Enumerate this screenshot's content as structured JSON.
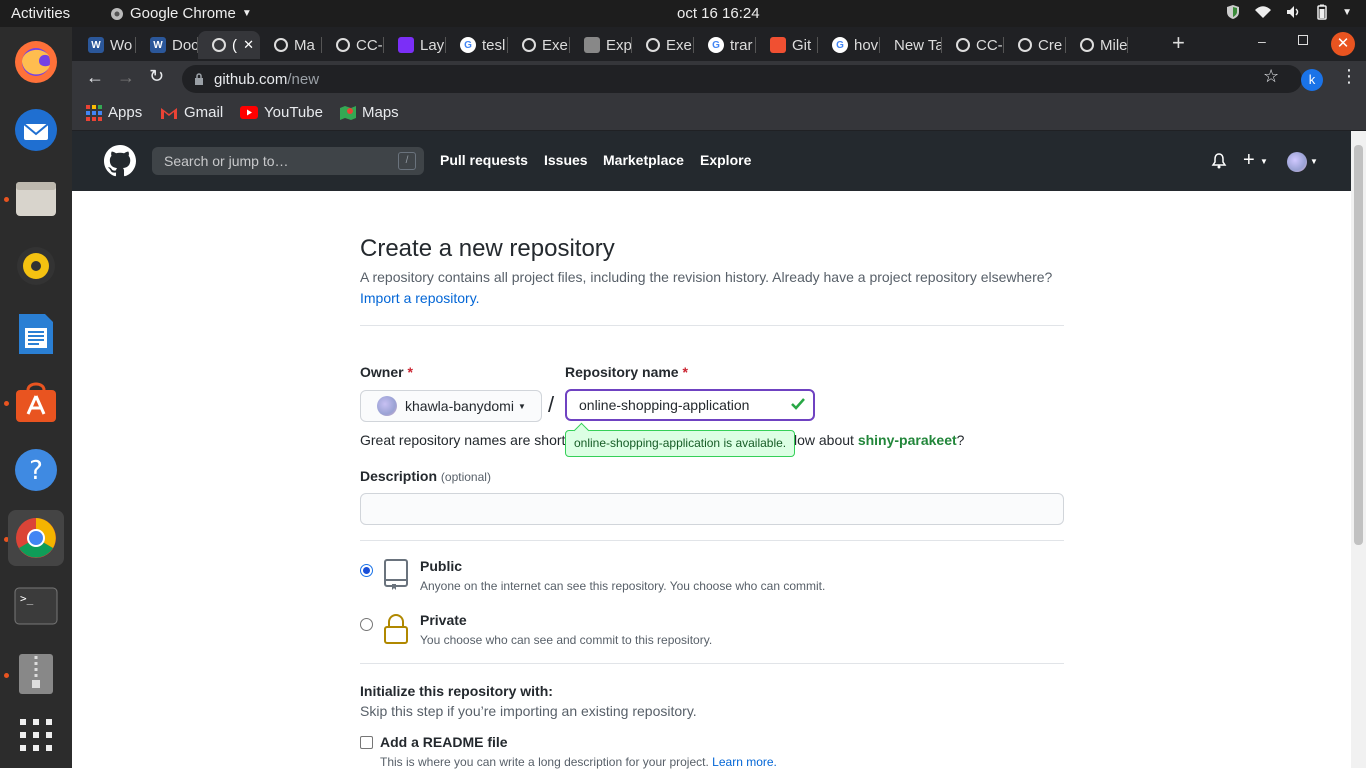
{
  "os": {
    "activities": "Activities",
    "app_name": "Google Chrome",
    "clock": "oct 16  16:24"
  },
  "dock": {
    "items": [
      "firefox",
      "thunderbird",
      "files",
      "rhythmbox",
      "libreoffice-writer",
      "ubuntu-software",
      "help",
      "chrome",
      "terminal",
      "archive-manager",
      "show-applications"
    ]
  },
  "tabs": [
    {
      "label": "Wo",
      "icon": "word-icon",
      "color": "#2b579a"
    },
    {
      "label": "Doc",
      "icon": "word-icon",
      "color": "#2b579a"
    },
    {
      "label": "(",
      "icon": "github-icon",
      "color": "#000000",
      "active": true
    },
    {
      "label": "Ma",
      "icon": "github-icon",
      "color": "#000000"
    },
    {
      "label": "CC-",
      "icon": "github-icon",
      "color": "#000000"
    },
    {
      "label": "Lay",
      "icon": "layout-icon",
      "color": "#7b2ff7"
    },
    {
      "label": "tesl",
      "icon": "google-icon",
      "color": "#4285f4"
    },
    {
      "label": "Exe",
      "icon": "github-icon",
      "color": "#000000"
    },
    {
      "label": "Exp",
      "icon": "gear-icon",
      "color": "#888888"
    },
    {
      "label": "Exe",
      "icon": "github-icon",
      "color": "#000000"
    },
    {
      "label": "trar",
      "icon": "google-icon",
      "color": "#4285f4"
    },
    {
      "label": "Git",
      "icon": "git-icon",
      "color": "#f05032"
    },
    {
      "label": "hov",
      "icon": "google-icon",
      "color": "#4285f4"
    },
    {
      "label": "New Ta",
      "icon": "",
      "color": ""
    },
    {
      "label": "CC-",
      "icon": "github-icon",
      "color": "#000000"
    },
    {
      "label": "Cre",
      "icon": "github-icon",
      "color": "#000000"
    },
    {
      "label": "Mile",
      "icon": "github-icon",
      "color": "#000000"
    }
  ],
  "omnibox": {
    "host": "github.com",
    "path": "/new"
  },
  "profile_initial": "k",
  "bookmarks": [
    {
      "label": "Apps",
      "icon": "apps-icon"
    },
    {
      "label": "Gmail",
      "icon": "gmail-icon"
    },
    {
      "label": "YouTube",
      "icon": "youtube-icon"
    },
    {
      "label": "Maps",
      "icon": "maps-icon"
    }
  ],
  "github": {
    "search_placeholder": "Search or jump to…",
    "search_key": "/",
    "nav": [
      "Pull requests",
      "Issues",
      "Marketplace",
      "Explore"
    ]
  },
  "page": {
    "title": "Create a new repository",
    "subtitle": "A repository contains all project files, including the revision history. Already have a project repository elsewhere?",
    "import_link": "Import a repository.",
    "owner_label": "Owner",
    "required_mark": "*",
    "repo_label": "Repository name",
    "owner_value": "khawla-banydomi",
    "slash": "/",
    "repo_value": "online-shopping-application",
    "tooltip": "online-shopping-application is available.",
    "hint_start": "Great repository names are short",
    "hint_end": "low about",
    "suggestion": "shiny-parakeet",
    "hint_q": "?",
    "desc_label": "Description",
    "desc_optional": "(optional)",
    "public_title": "Public",
    "public_desc": "Anyone on the internet can see this repository. You choose who can commit.",
    "private_title": "Private",
    "private_desc": "You choose who can see and commit to this repository.",
    "init_title": "Initialize this repository with:",
    "init_desc": "Skip this step if you’re importing an existing repository.",
    "readme_label": "Add a README file",
    "readme_desc": "This is where you can write a long description for your project.",
    "learn_more": "Learn more."
  }
}
